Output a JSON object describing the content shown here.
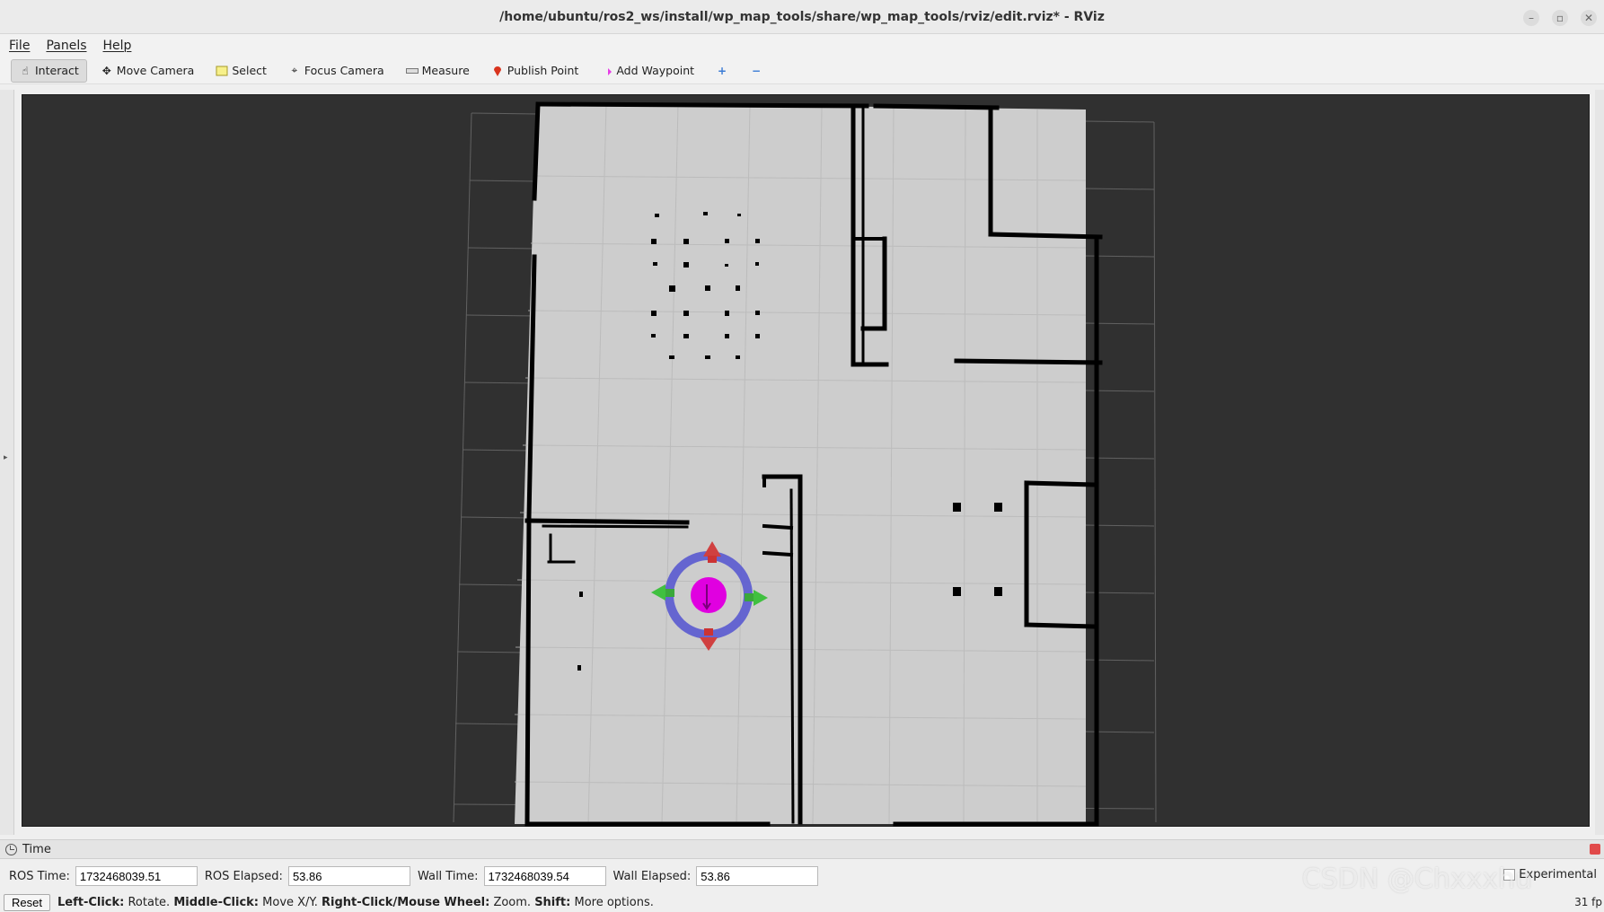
{
  "window": {
    "title": "/home/ubuntu/ros2_ws/install/wp_map_tools/share/wp_map_tools/rviz/edit.rviz* - RViz"
  },
  "menu": {
    "file": "File",
    "panels": "Panels",
    "help": "Help"
  },
  "toolbar": {
    "interact": "Interact",
    "move_camera": "Move Camera",
    "select": "Select",
    "focus_camera": "Focus Camera",
    "measure": "Measure",
    "publish_point": "Publish Point",
    "add_waypoint": "Add Waypoint"
  },
  "time_panel": {
    "title": "Time",
    "ros_time_label": "ROS Time:",
    "ros_time_value": "1732468039.51",
    "ros_elapsed_label": "ROS Elapsed:",
    "ros_elapsed_value": "53.86",
    "wall_time_label": "Wall Time:",
    "wall_time_value": "1732468039.54",
    "wall_elapsed_label": "Wall Elapsed:",
    "wall_elapsed_value": "53.86",
    "experimental_label": "Experimental"
  },
  "status": {
    "reset": "Reset",
    "hint_left_bold": "Left-Click:",
    "hint_left": "Rotate.",
    "hint_middle_bold": "Middle-Click:",
    "hint_middle": "Move X/Y.",
    "hint_right_bold": "Right-Click/Mouse Wheel:",
    "hint_right": "Zoom.",
    "hint_shift_bold": "Shift:",
    "hint_shift": "More options.",
    "fps": "31 fp"
  },
  "watermark": "CSDN @Chxxxhu",
  "colors": {
    "viewport_bg": "#303030",
    "map_free": "#cdcdcd",
    "map_wall": "#000000",
    "marker_ring": "#5a5ad0",
    "marker_core": "#e000e0",
    "arrow_red": "#d04040",
    "arrow_green": "#40c040"
  }
}
